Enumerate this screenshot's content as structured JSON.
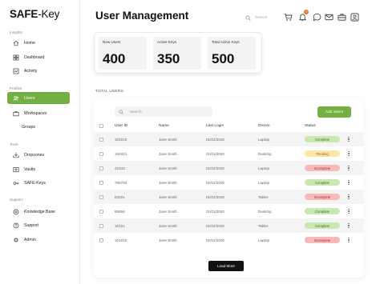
{
  "app": {
    "logo_bold": "SAFE",
    "logo_light": "-Key"
  },
  "sidebar": {
    "sections": [
      {
        "label": "Insights"
      },
      {
        "label": "Profiles"
      },
      {
        "label": "Tools"
      },
      {
        "label": "Support"
      }
    ],
    "items": [
      {
        "label": "Home",
        "icon": "home-icon"
      },
      {
        "label": "Dashboard",
        "icon": "dashboard-icon"
      },
      {
        "label": "Activity",
        "icon": "activity-icon"
      },
      {
        "label": "Users",
        "icon": "users-icon"
      },
      {
        "label": "Workspaces",
        "icon": "workspaces-icon"
      },
      {
        "label": "Groups",
        "icon": ""
      },
      {
        "label": "Dropzones",
        "icon": "dropzones-icon"
      },
      {
        "label": "Vaults",
        "icon": "vaults-icon"
      },
      {
        "label": "SAFE-Keys",
        "icon": "key-icon"
      },
      {
        "label": "Knowledge Base",
        "icon": "knowledge-base-icon"
      },
      {
        "label": "Support",
        "icon": "support-icon"
      },
      {
        "label": "Admin",
        "icon": "admin-icon"
      }
    ]
  },
  "header": {
    "title": "User Management",
    "search_placeholder": "Search",
    "notification_count": "3"
  },
  "stats": [
    {
      "label": "New Users",
      "value": "400"
    },
    {
      "label": "Active Keys",
      "value": "350"
    },
    {
      "label": "Total Active Keys",
      "value": "500"
    }
  ],
  "table": {
    "section_label": "TOTAL USERS",
    "search_placeholder": "Search",
    "add_button": "Add Users",
    "columns": [
      "User ID",
      "Name",
      "Last Login",
      "Device",
      "Status"
    ],
    "rows": [
      {
        "id": "101010",
        "name": "Jane Smith",
        "login": "01/01/2020",
        "device": "Laptop",
        "status": "Complete",
        "status_class": "complete"
      },
      {
        "id": "120321",
        "name": "Jane Smith",
        "login": "01/01/2020",
        "device": "Desktop",
        "status": "Pending",
        "status_class": "pending"
      },
      {
        "id": "42342",
        "name": "Jane Smith",
        "login": "01/01/2020",
        "device": "Laptop",
        "status": "Incomplete",
        "status_class": "incomplete"
      },
      {
        "id": "785763",
        "name": "Jane Smith",
        "login": "01/01/2020",
        "device": "Laptop",
        "status": "Complete",
        "status_class": "complete"
      },
      {
        "id": "83221",
        "name": "Jane Smith",
        "login": "01/01/2020",
        "device": "Tablet",
        "status": "Incomplete",
        "status_class": "incomplete"
      },
      {
        "id": "65656",
        "name": "Jane Smith",
        "login": "01/01/2020",
        "device": "Desktop",
        "status": "Complete",
        "status_class": "complete"
      },
      {
        "id": "10101",
        "name": "Jane Smith",
        "login": "01/01/2020",
        "device": "Tablet",
        "status": "Complete",
        "status_class": "complete"
      },
      {
        "id": "101010",
        "name": "Jane Smith",
        "login": "01/01/2020",
        "device": "Laptop",
        "status": "Incomplete",
        "status_class": "incomplete"
      }
    ],
    "load_more": "Load More"
  },
  "colors": {
    "accent": "#72b041",
    "badge": "#ef6b34"
  }
}
